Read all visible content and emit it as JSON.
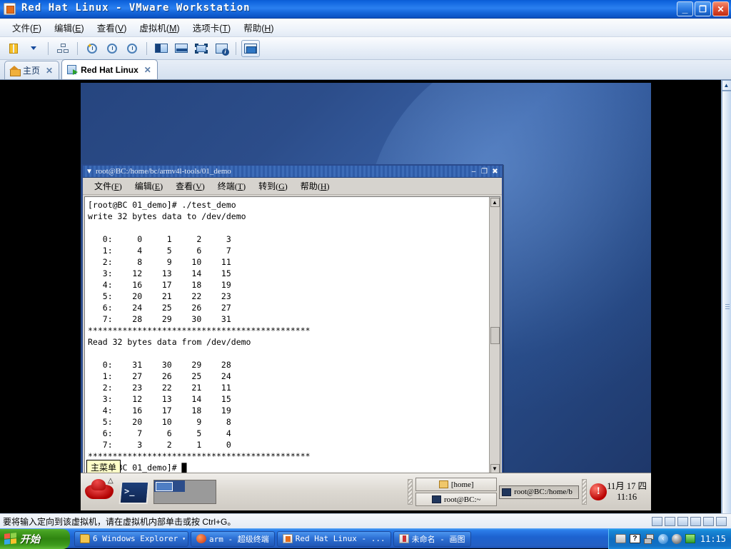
{
  "vmware": {
    "title": "Red Hat Linux - VMware Workstation",
    "window_buttons": {
      "minimize": "_",
      "restore": "❐",
      "close": "✕"
    },
    "menus": [
      {
        "label": "文件",
        "accel": "F"
      },
      {
        "label": "编辑",
        "accel": "E"
      },
      {
        "label": "查看",
        "accel": "V"
      },
      {
        "label": "虚拟机",
        "accel": "M"
      },
      {
        "label": "选项卡",
        "accel": "T"
      },
      {
        "label": "帮助",
        "accel": "H"
      }
    ],
    "toolbar": [
      {
        "name": "suspend-icon"
      },
      {
        "name": "dropdown-caret-icon"
      },
      {
        "name": "manage-snapshots-icon"
      },
      {
        "name": "take-snapshot-icon"
      },
      {
        "name": "revert-snapshot-icon"
      },
      {
        "name": "snapshot-manager-icon"
      },
      {
        "name": "show-sidebar-icon"
      },
      {
        "name": "show-console-view-icon"
      },
      {
        "name": "full-screen-icon"
      },
      {
        "name": "vm-settings-icon"
      },
      {
        "name": "unity-mode-icon"
      }
    ],
    "tabs": [
      {
        "label": "主页",
        "active": false,
        "icon": "home-icon",
        "close": "✕"
      },
      {
        "label": "Red Hat Linux",
        "active": true,
        "icon": "vm-icon",
        "close": "✕"
      }
    ],
    "status_text": "要将输入定向到该虚拟机，请在虚拟机内部单击或按 Ctrl+G。"
  },
  "terminal": {
    "title": "root@BC:/home/bc/armv4l-tools/01_demo",
    "window_buttons": {
      "minimize": "–",
      "maximize": "❐",
      "close": "✖"
    },
    "menus": [
      {
        "label": "文件",
        "accel": "F"
      },
      {
        "label": "编辑",
        "accel": "E"
      },
      {
        "label": "查看",
        "accel": "V"
      },
      {
        "label": "终端",
        "accel": "T"
      },
      {
        "label": "转到",
        "accel": "G"
      },
      {
        "label": "帮助",
        "accel": "H"
      }
    ],
    "output": "[root@BC 01_demo]# ./test_demo\nwrite 32 bytes data to /dev/demo\n\n   0:     0     1     2     3\n   1:     4     5     6     7\n   2:     8     9    10    11\n   3:    12    13    14    15\n   4:    16    17    18    19\n   5:    20    21    22    23\n   6:    24    25    26    27\n   7:    28    29    30    31\n*********************************************\nRead 32 bytes data from /dev/demo\n\n   0:    31    30    29    28\n   1:    27    26    25    24\n   2:    23    22    21    11\n   3:    12    13    14    15\n   4:    16    17    18    19\n   5:    20    10     9     8\n   6:     7     6     5     4\n   7:     3     2     1     0\n*********************************************\n[root@BC 01_demo]# █",
    "scroll_up": "▲",
    "scroll_down": "▼"
  },
  "guest_panel": {
    "tooltip": "主菜单",
    "launchers": [
      {
        "name": "main-menu-icon",
        "label": "主菜单"
      },
      {
        "name": "terminal-launcher-icon",
        "label": "终端"
      }
    ],
    "window_list": [
      {
        "label": "[home]",
        "icon": "folder-icon",
        "pressed": false
      },
      {
        "label": "root@BC:~",
        "icon": "terminal-icon",
        "pressed": false
      },
      {
        "label": "root@BC:/home/b",
        "icon": "terminal-icon",
        "pressed": true
      }
    ],
    "tray_alert": "!",
    "clock_date": "11月 17 四",
    "clock_time": "11:16"
  },
  "windows_taskbar": {
    "start_label": "开始",
    "items": [
      {
        "label": "6 Windows Explorer",
        "icon": "folder-icon",
        "group": true,
        "dropdown": "▾"
      },
      {
        "label": "arm - 超级终端",
        "icon": "hyperterminal-icon",
        "group": false
      },
      {
        "label": "Red Hat Linux - ...",
        "icon": "vmware-icon",
        "group": false,
        "active": true
      },
      {
        "label": "未命名 - 画图",
        "icon": "paint-icon",
        "group": false
      }
    ],
    "tray": [
      {
        "name": "keyboard-layout-icon"
      },
      {
        "name": "help-icon",
        "glyph": "?"
      },
      {
        "name": "network-icon"
      },
      {
        "name": "updates-icon",
        "glyph": "‹"
      },
      {
        "name": "user-account-icon"
      },
      {
        "name": "vmware-tray-icon"
      }
    ],
    "clock": "11:15"
  }
}
